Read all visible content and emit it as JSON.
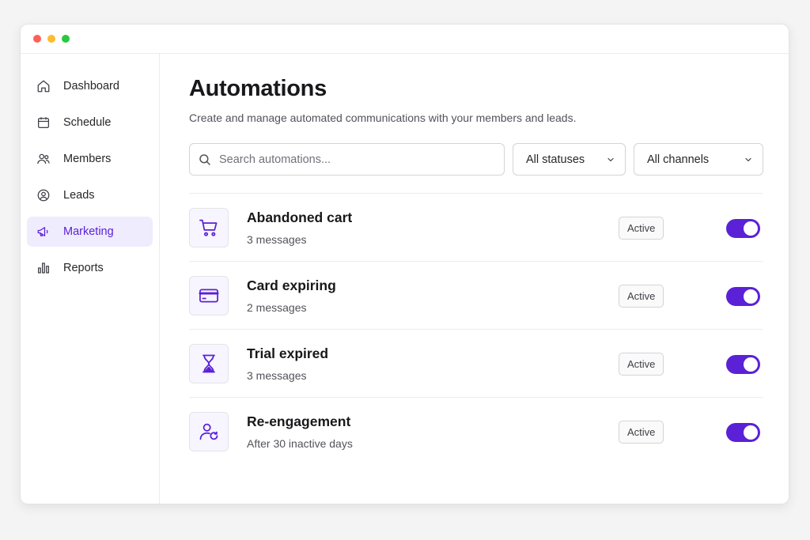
{
  "colors": {
    "accent": "#5b21d6",
    "active_nav_bg": "#efecfd"
  },
  "sidebar": {
    "items": [
      {
        "label": "Dashboard",
        "icon": "home-icon"
      },
      {
        "label": "Schedule",
        "icon": "calendar-icon"
      },
      {
        "label": "Members",
        "icon": "users-icon"
      },
      {
        "label": "Leads",
        "icon": "user-circle-icon"
      },
      {
        "label": "Marketing",
        "icon": "megaphone-icon",
        "active": true
      },
      {
        "label": "Reports",
        "icon": "bar-chart-icon"
      }
    ]
  },
  "main": {
    "title": "Automations",
    "subtitle": "Create and manage automated communications with your members and leads.",
    "search": {
      "placeholder": "Search automations..."
    },
    "filters": {
      "status": "All statuses",
      "channels": "All channels"
    },
    "automations": [
      {
        "title": "Abandoned cart",
        "subtitle": "3 messages",
        "status": "Active",
        "enabled": true,
        "icon": "shopping-cart-icon"
      },
      {
        "title": "Card expiring",
        "subtitle": "2 messages",
        "status": "Active",
        "enabled": true,
        "icon": "credit-card-icon"
      },
      {
        "title": "Trial expired",
        "subtitle": "3 messages",
        "status": "Active",
        "enabled": true,
        "icon": "hourglass-icon"
      },
      {
        "title": "Re-engagement",
        "subtitle": "After 30 inactive days",
        "status": "Active",
        "enabled": true,
        "icon": "user-refresh-icon"
      }
    ]
  }
}
